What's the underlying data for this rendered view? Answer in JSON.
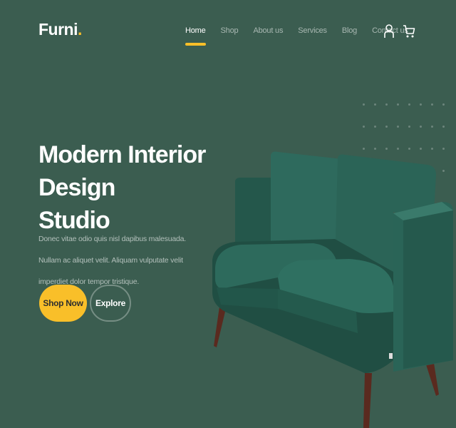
{
  "brand": {
    "name": "Furni",
    "dot": "."
  },
  "nav": {
    "items": [
      "Home",
      "Shop",
      "About us",
      "Services",
      "Blog",
      "Contact us"
    ],
    "active": "Home"
  },
  "icons": {
    "user": "user-icon",
    "cart": "cart-icon"
  },
  "hero": {
    "title_line1": "Modern Interior Design",
    "title_line2": "Studio",
    "description": "Donec vitae odio quis nisl dapibus malesuada. Nullam ac aliquet velit. Aliquam vulputate velit imperdiet dolor tempor tristique.",
    "primary_button": "Shop Now",
    "secondary_button": "Explore"
  },
  "colors": {
    "background": "#3b5d50",
    "accent": "#f9bf29",
    "sofa": "#2f6b5e"
  }
}
